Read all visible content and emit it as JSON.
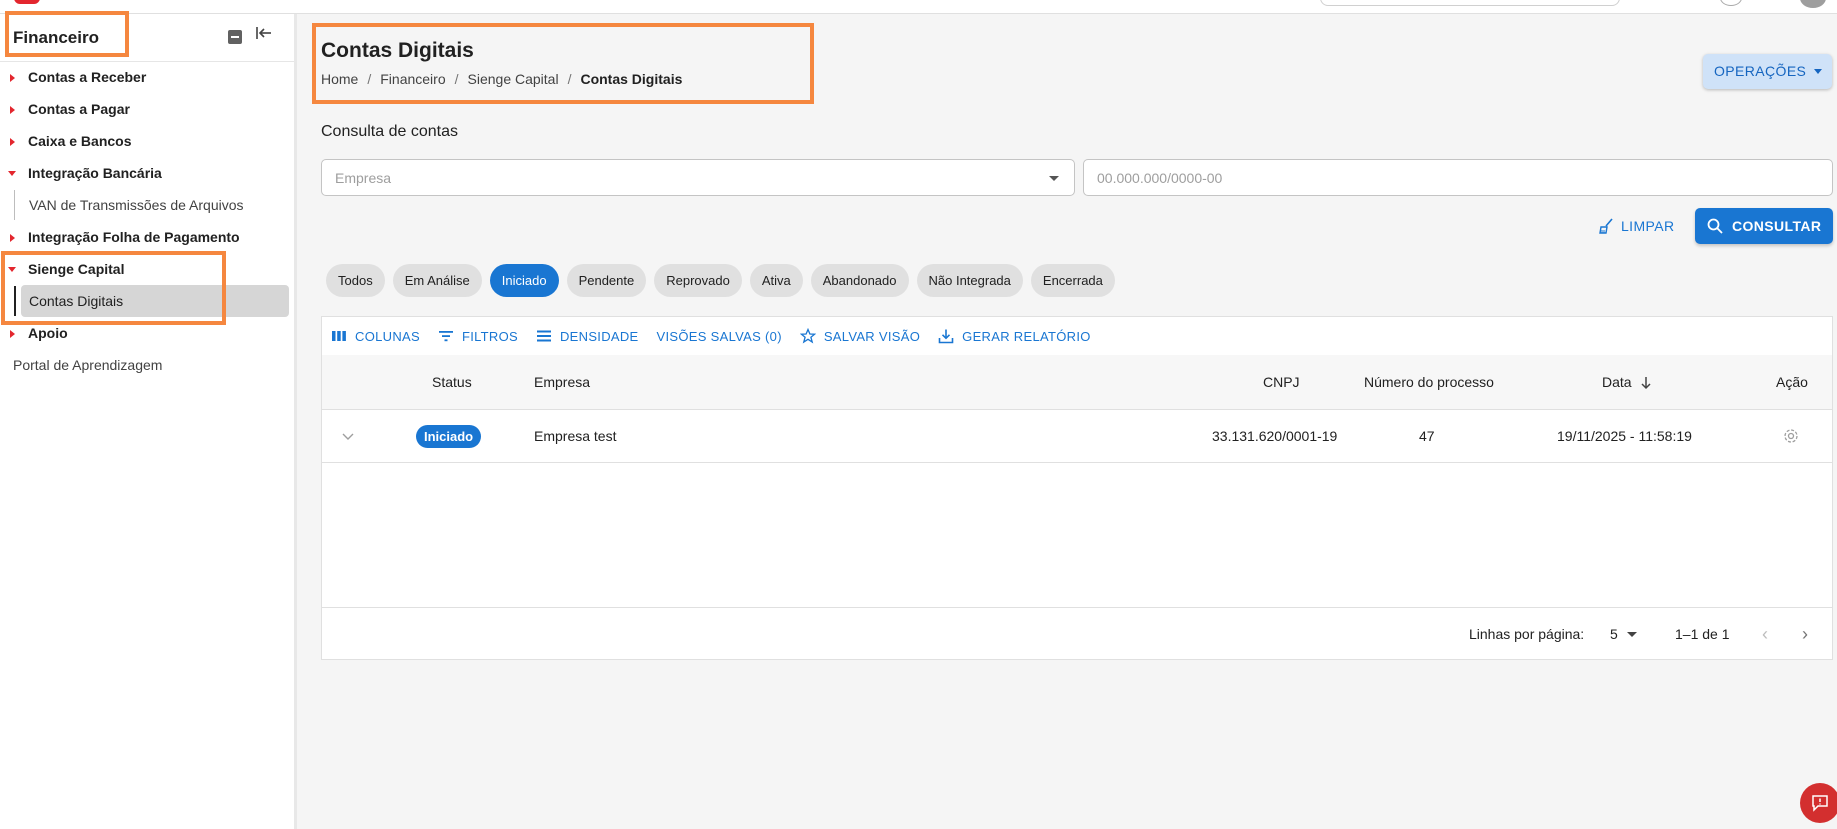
{
  "sidebar": {
    "title": "Financeiro",
    "collapse_all_icon": "collapse-all-icon",
    "hide_icon": "sidebar-collapse-icon",
    "items": [
      {
        "label": "Contas a Receber",
        "expanded": false
      },
      {
        "label": "Contas a Pagar",
        "expanded": false
      },
      {
        "label": "Caixa e Bancos",
        "expanded": false
      },
      {
        "label": "Integração Bancária",
        "expanded": true,
        "children": [
          "VAN de Transmissões de Arquivos"
        ]
      },
      {
        "label": "Integração Folha de Pagamento",
        "expanded": false
      },
      {
        "label": "Sienge Capital",
        "expanded": true,
        "children": [
          "Contas Digitais"
        ]
      },
      {
        "label": "Apoio",
        "expanded": false
      }
    ],
    "footer_link": "Portal de Aprendizagem"
  },
  "header": {
    "title": "Contas Digitais",
    "breadcrumb": [
      "Home",
      "Financeiro",
      "Sienge Capital",
      "Contas Digitais"
    ],
    "operations_label": "OPERAÇÕES"
  },
  "search": {
    "section_title": "Consulta de contas",
    "empresa_placeholder": "Empresa",
    "cnpj_placeholder": "00.000.000/0000-00",
    "clear_label": "LIMPAR",
    "submit_label": "CONSULTAR"
  },
  "filters": {
    "chips": [
      "Todos",
      "Em Análise",
      "Iniciado",
      "Pendente",
      "Reprovado",
      "Ativa",
      "Abandonado",
      "Não Integrada",
      "Encerrada"
    ],
    "active": "Iniciado"
  },
  "grid": {
    "toolbar": {
      "columns": "COLUNAS",
      "filters": "FILTROS",
      "density": "DENSIDADE",
      "saved_views": "VISÕES SALVAS (0)",
      "save_view": "SALVAR VISÃO",
      "report": "GERAR RELATÓRIO"
    },
    "headers": {
      "status": "Status",
      "empresa": "Empresa",
      "cnpj": "CNPJ",
      "processo": "Número do processo",
      "data": "Data",
      "acao": "Ação"
    },
    "rows": [
      {
        "status": "Iniciado",
        "empresa": "Empresa test",
        "cnpj": "33.131.620/0001-19",
        "processo": "47",
        "data": "19/11/2025 - 11:58:19"
      }
    ],
    "footer": {
      "rows_per_page_label": "Linhas por página:",
      "rows_per_page": "5",
      "range": "1–1 de 1"
    }
  },
  "colors": {
    "accent": "#1976d2",
    "brand_red": "#e3262e",
    "highlight": "#f5873f"
  }
}
